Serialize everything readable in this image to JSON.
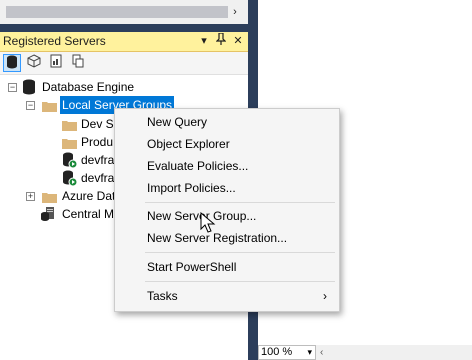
{
  "panel": {
    "title": "Registered Servers",
    "buttons": {
      "pin": "▾",
      "autohide": "⬪",
      "close": "✕"
    }
  },
  "toolbar": {
    "items": [
      "database-engine-icon",
      "analysis-services-icon",
      "reporting-services-icon",
      "integration-services-icon"
    ]
  },
  "tree": {
    "root": {
      "label": "Database Engine",
      "expander": "−"
    },
    "group": {
      "label": "Local Server Groups",
      "expander": "−"
    },
    "children": [
      {
        "label": "Dev Se"
      },
      {
        "label": "Produ"
      },
      {
        "label": "devfra"
      },
      {
        "label": "devfra"
      }
    ],
    "azure": {
      "label": "Azure Dat",
      "expander": "+"
    },
    "central": {
      "label": "Central M"
    }
  },
  "menu": {
    "items": [
      {
        "label": "New Query"
      },
      {
        "label": "Object Explorer"
      },
      {
        "label": "Evaluate Policies..."
      },
      {
        "label": "Import Policies..."
      },
      {
        "label": "New Server Group..."
      },
      {
        "label": "New Server Registration..."
      },
      {
        "label": "Start PowerShell"
      },
      {
        "label": "Tasks",
        "submenu": "›"
      }
    ]
  },
  "editor": {
    "zoom": "100 %",
    "zoom_chevron": "▾"
  },
  "scroll": {
    "right_arrow": "›",
    "left_arrow": "‹"
  }
}
